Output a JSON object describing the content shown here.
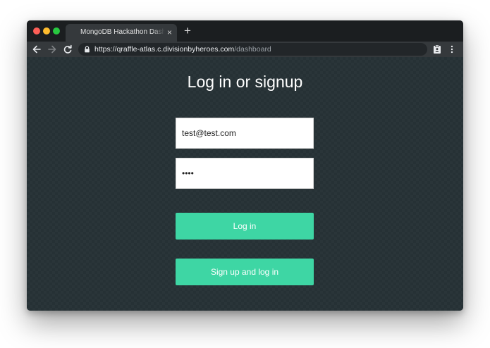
{
  "browser": {
    "tab_title": "MongoDB Hackathon Dashboard",
    "tab_close": "×",
    "new_tab": "+",
    "url_host": "https://qraffle-atlas.c.divisionbyheroes.com",
    "url_path": "/dashboard",
    "icons": {
      "close": "traffic-light-close",
      "minimize": "traffic-light-minimize",
      "maximize": "traffic-light-maximize",
      "back": "back-arrow",
      "forward": "forward-arrow",
      "reload": "reload",
      "lock": "lock",
      "extension": "clipboard-badge",
      "menu": "kebab-menu"
    }
  },
  "page": {
    "heading": "Log in or signup",
    "email_value": "test@test.com",
    "password_value": "test",
    "login_label": "Log in",
    "signup_label": "Sign up and log in"
  },
  "colors": {
    "page_background": "#263135",
    "button": "#3ed6a4",
    "titlebar": "#1b1e20",
    "toolbar": "#35393c"
  }
}
